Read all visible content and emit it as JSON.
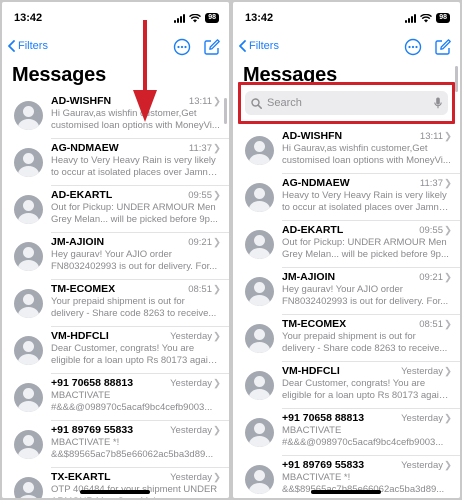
{
  "status": {
    "time": "13:42",
    "battery": "98"
  },
  "nav": {
    "back_label": "Filters",
    "title": "Messages"
  },
  "search": {
    "placeholder": "Search"
  },
  "icons": {
    "back": "chevron-left-icon",
    "more": "ellipsis-circle-icon",
    "compose": "compose-icon",
    "search": "magnifier-icon",
    "mic": "microphone-icon",
    "avatar": "person-silhouette-icon",
    "annotation_arrow": "down-arrow-icon"
  },
  "colors": {
    "accent": "#1a7ef7",
    "annotation": "#d0202a",
    "avatar": "#a4a8b0"
  },
  "left_messages": [
    {
      "sender": "AD-WISHFN",
      "time": "13:11",
      "line1": "Hi Gaurav,as wishfin customer,Get",
      "line2": "customised loan options with MoneyVi..."
    },
    {
      "sender": "AG-NDMAEW",
      "time": "11:37",
      "line1": "Heavy to Very Heavy Rain is very likely",
      "line2": "to occur at isolated places over Jamna..."
    },
    {
      "sender": "AD-EKARTL",
      "time": "09:55",
      "line1": "Out for Pickup: UNDER ARMOUR Men",
      "line2": "Grey Melan... will be picked before 9p..."
    },
    {
      "sender": "JM-AJIOIN",
      "time": "09:21",
      "line1": "Hey gaurav! Your AJIO order",
      "line2": "FN8032402993 is out for delivery. For..."
    },
    {
      "sender": "TM-ECOMEX",
      "time": "08:51",
      "line1": "Your prepaid shipment is out for",
      "line2": "delivery - Share code 8263 to receive..."
    },
    {
      "sender": "VM-HDFCLI",
      "time": "Yesterday",
      "line1": "Dear Customer, congrats! You are",
      "line2": "eligible for a loan upto Rs 80173 again..."
    },
    {
      "sender": "+91 70658 88813",
      "time": "Yesterday",
      "line1": "MBACTIVATE",
      "line2": "#&&&@098970c5acaf9bc4cefb9003..."
    },
    {
      "sender": "+91 89769 55833",
      "time": "Yesterday",
      "line1": "MBACTIVATE *!",
      "line2": "&&$89565ac7b85e66062ac5ba3d89..."
    },
    {
      "sender": "TX-EKARTL",
      "time": "Yesterday",
      "line1": "OTP 406484 for your shipment UNDER",
      "line2": "ARMOUR Men Grey Melan..."
    }
  ],
  "right_messages": [
    {
      "sender": "AD-WISHFN",
      "time": "13:11",
      "line1": "Hi Gaurav,as wishfin customer,Get",
      "line2": "customised loan options with MoneyVi..."
    },
    {
      "sender": "AG-NDMAEW",
      "time": "11:37",
      "line1": "Heavy to Very Heavy Rain is very likely",
      "line2": "to occur at isolated places over Jamna..."
    },
    {
      "sender": "AD-EKARTL",
      "time": "09:55",
      "line1": "Out for Pickup: UNDER ARMOUR Men",
      "line2": "Grey Melan... will be picked before 9p..."
    },
    {
      "sender": "JM-AJIOIN",
      "time": "09:21",
      "line1": "Hey gaurav! Your AJIO order",
      "line2": "FN8032402993 is out for delivery. For..."
    },
    {
      "sender": "TM-ECOMEX",
      "time": "08:51",
      "line1": "Your prepaid shipment is out for",
      "line2": "delivery - Share code 8263 to receive..."
    },
    {
      "sender": "VM-HDFCLI",
      "time": "Yesterday",
      "line1": "Dear Customer, congrats! You are",
      "line2": "eligible for a loan upto Rs 80173 again..."
    },
    {
      "sender": "+91 70658 88813",
      "time": "Yesterday",
      "line1": "MBACTIVATE",
      "line2": "#&&&@098970c5acaf9bc4cefb9003..."
    },
    {
      "sender": "+91 89769 55833",
      "time": "Yesterday",
      "line1": "MBACTIVATE *!",
      "line2": "&&$89565ac7b85e66062ac5ba3d89..."
    }
  ]
}
